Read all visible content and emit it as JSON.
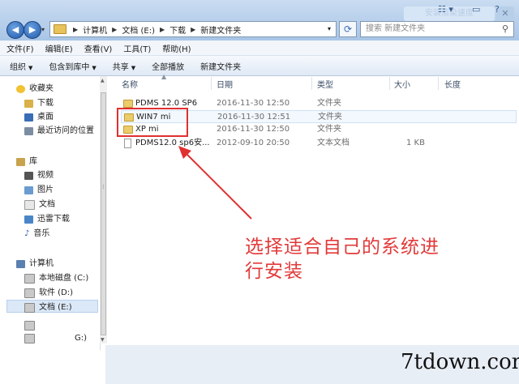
{
  "window": {
    "ghost_button": "安装渲染速度",
    "close_glyph": "✕"
  },
  "address_bar": {
    "crumbs": [
      "计算机",
      "文档 (E:)",
      "下载",
      "新建文件夹"
    ],
    "search_placeholder": "搜索 新建文件夹"
  },
  "menu": [
    "文件(F)",
    "编辑(E)",
    "查看(V)",
    "工具(T)",
    "帮助(H)"
  ],
  "toolbar": {
    "organize": "组织",
    "include": "包含到库中",
    "share": "共享",
    "play_all": "全部播放",
    "new_folder": "新建文件夹"
  },
  "nav": {
    "favorites": "收藏夹",
    "fav_items": [
      "下载",
      "桌面",
      "最近访问的位置"
    ],
    "libraries": "库",
    "lib_items": [
      "视频",
      "图片",
      "文档",
      "迅雷下载",
      "音乐"
    ],
    "computer": "计算机",
    "drives": [
      "本地磁盘 (C:)",
      "软件 (D:)",
      "文档 (E:)"
    ],
    "partial_drive": "G:)"
  },
  "columns": {
    "name": "名称",
    "date": "日期",
    "type": "类型",
    "size": "大小",
    "length": "长度"
  },
  "files": [
    {
      "name": "PDMS 12.0 SP6",
      "date": "2016-11-30 12:50",
      "type": "文件夹",
      "size": ""
    },
    {
      "name": "WIN7 mi",
      "date": "2016-11-30 12:51",
      "type": "文件夹",
      "size": ""
    },
    {
      "name": "XP mi",
      "date": "2016-11-30 12:50",
      "type": "文件夹",
      "size": ""
    },
    {
      "name": "PDMS12.0 sp6安...",
      "date": "2012-09-10 20:50",
      "type": "文本文档",
      "size": "1 KB"
    }
  ],
  "annotation": {
    "line1": "选择适合自己的系统进",
    "line2": "行安装",
    "color": "#e23a3a"
  },
  "watermark": "7tdown.com"
}
